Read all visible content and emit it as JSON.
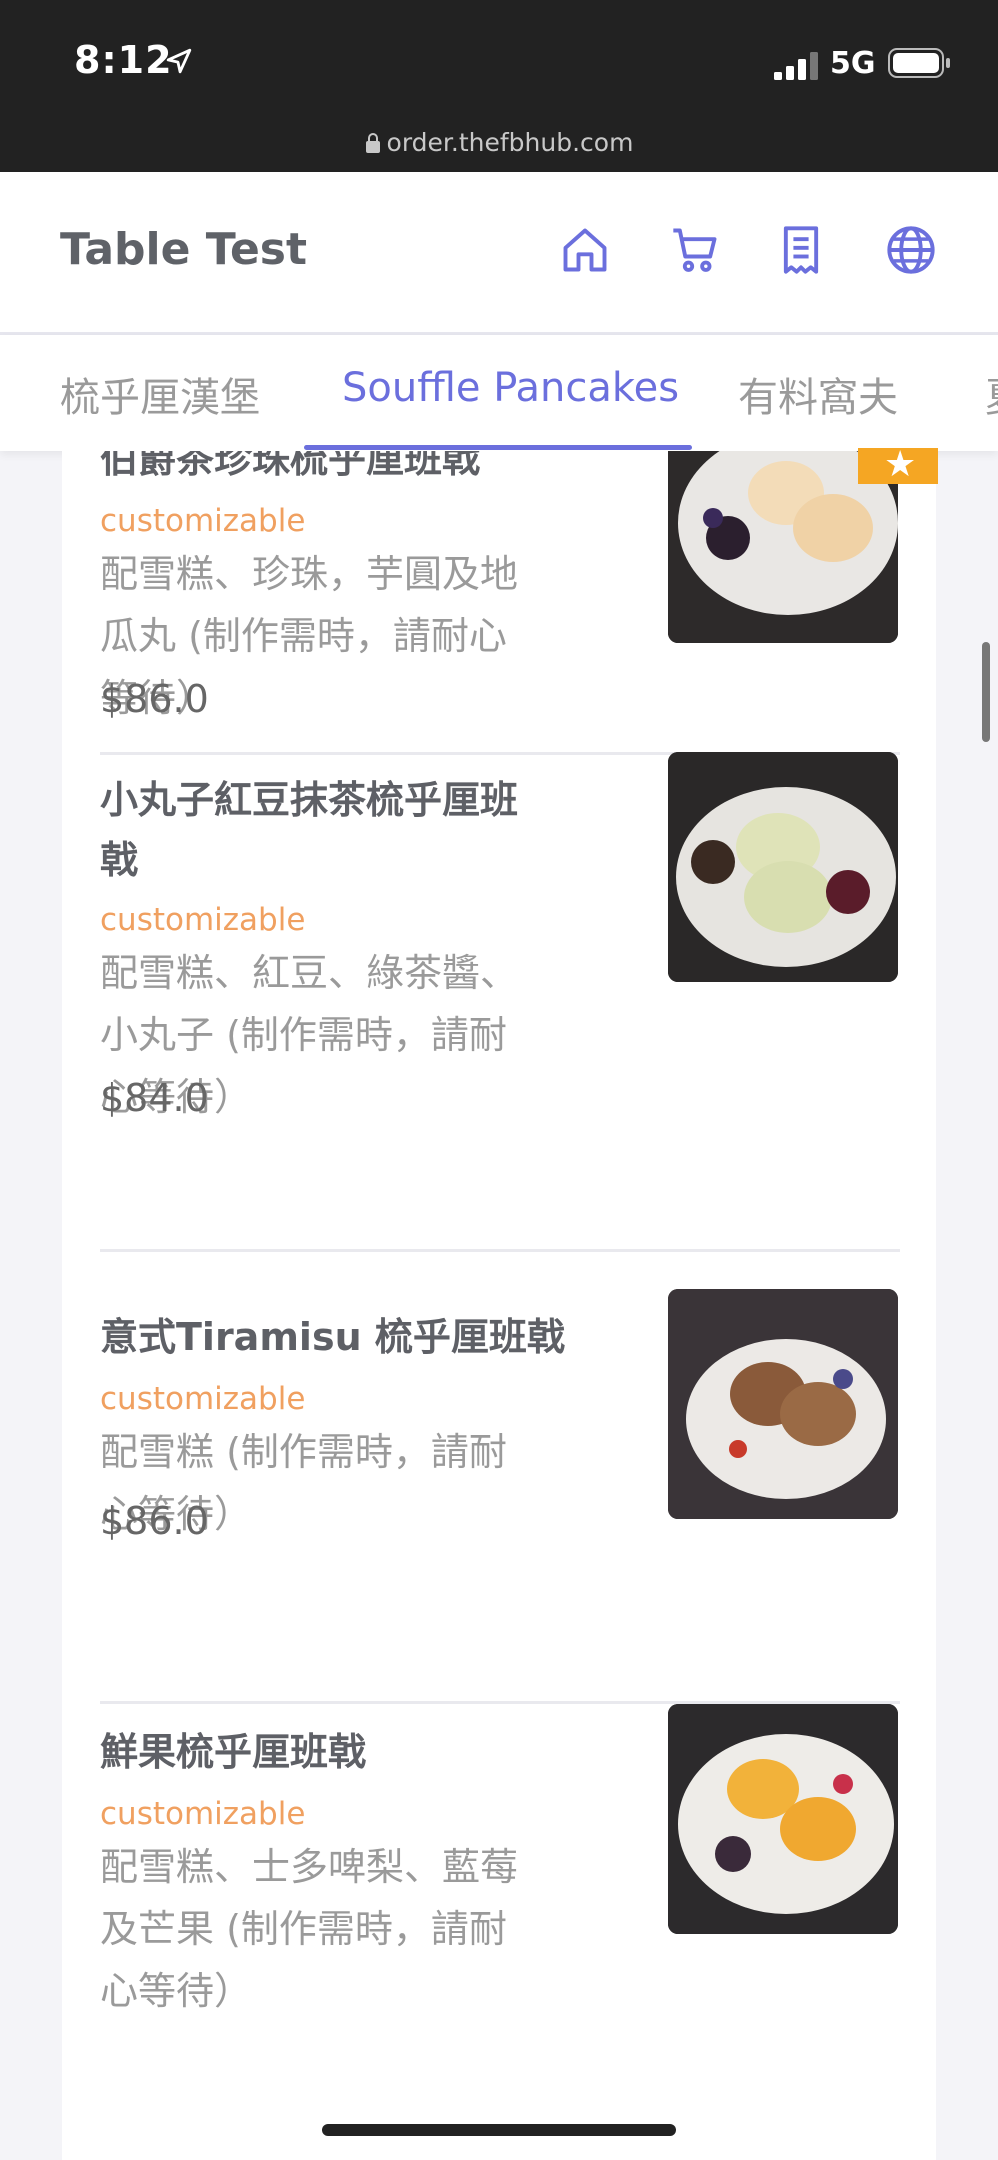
{
  "status": {
    "time": "8:12",
    "network": "5G",
    "url": "order.thefbhub.com"
  },
  "header": {
    "title": "Table Test",
    "icons": [
      "home-icon",
      "cart-icon",
      "receipt-icon",
      "globe-icon"
    ],
    "accent": "#6b6fdd"
  },
  "tabs": [
    {
      "label": "梳乎厘漢堡"
    },
    {
      "label": "Souffle Pancakes"
    },
    {
      "label": "有料窩夫"
    },
    {
      "label": "夏"
    }
  ],
  "items": [
    {
      "name": "伯爵茶珍珠梳乎厘班戟",
      "tag": "customizable",
      "desc": [
        "配雪糕、珍珠，芋圓及地",
        "瓜丸 (制作需時，請耐心",
        "等待）"
      ],
      "price": "$86.0"
    },
    {
      "name": [
        "小丸子紅豆抹茶梳乎厘班",
        "戟"
      ],
      "tag": "customizable",
      "desc": [
        "配雪糕、紅豆、綠茶醬、",
        "小丸子 (制作需時，請耐",
        "心等待）"
      ],
      "price": "$84.0"
    },
    {
      "name": "意式Tiramisu 梳乎厘班戟",
      "tag": "customizable",
      "desc": [
        "配雪糕 (制作需時，請耐",
        "心等待）"
      ],
      "price": "$86.0"
    },
    {
      "name": "鮮果梳乎厘班戟",
      "tag": "customizable",
      "desc": [
        "配雪糕、士多啤梨、藍莓",
        "及芒果 (制作需時，請耐",
        "心等待）"
      ]
    }
  ],
  "colors": {
    "tag": "#f0a060",
    "badge": "#f5a623"
  }
}
